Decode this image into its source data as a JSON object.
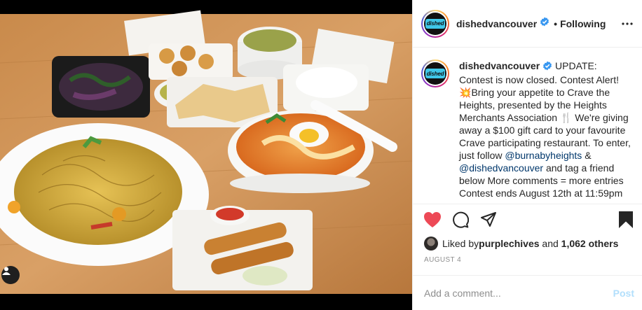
{
  "post": {
    "username": "dishedvancouver",
    "avatar_text": "dished",
    "follow_status": "Following",
    "separator": "•",
    "more_icon": "more-horizontal-icon",
    "verified_icon": "verified-badge-icon"
  },
  "caption": {
    "username": "dishedvancouver",
    "part1": " UPDATE: Contest is now closed. Contest Alert! ",
    "emoji1": "💥",
    "part2": "Bring your appetite to Crave the Heights, presented by the Heights Merchants Association ",
    "emoji2": "🍴",
    "part3": " We're giving away a $100 gift card to your favourite Crave participating restaurant. To enter, just follow ",
    "mention1": "@burnabyheights",
    "part4": " & ",
    "mention2": "@dishedvancouver",
    "part5": " and tag a friend below More comments = more entries Contest ends August 12th at 11:59pm"
  },
  "actions": {
    "like_icon": "heart-filled-icon",
    "comment_icon": "comment-icon",
    "share_icon": "share-icon",
    "save_icon": "bookmark-filled-icon"
  },
  "likes": {
    "prefix": "Liked by ",
    "user": "purplechives",
    "middle": " and ",
    "others": "1,062 others"
  },
  "date": "AUGUST 4",
  "comment": {
    "placeholder": "Add a comment...",
    "post_label": "Post"
  },
  "colors": {
    "like_red": "#ed4956",
    "verified_blue": "#3897f0",
    "post_disabled": "#b2dffc",
    "mention": "#00376b"
  }
}
